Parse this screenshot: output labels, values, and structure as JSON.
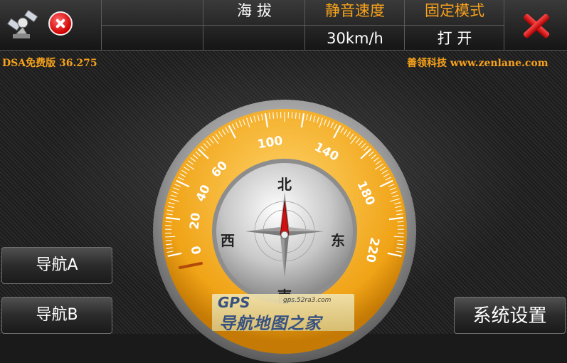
{
  "header": {
    "altitude_label": "海 拔",
    "altitude_value": "",
    "mute_speed_label": "静音速度",
    "mute_speed_value": "30km/h",
    "fixed_mode_label": "固定模式",
    "fixed_mode_value": "打 开"
  },
  "info": {
    "version": "DSA免费版 36.275",
    "company": "善领科技 www.zenlane.com"
  },
  "buttons": {
    "nav_a": "导航A",
    "nav_b": "导航B",
    "settings": "系统设置"
  },
  "gauge": {
    "speed_ticks": [
      "0",
      "20",
      "40",
      "60",
      "100",
      "140",
      "180",
      "220"
    ],
    "compass": {
      "north": "北",
      "east": "东",
      "west": "西",
      "south": "南"
    }
  },
  "watermark": {
    "logo": "GPS",
    "url": "gps.52ra3.com",
    "title": "导航地图之家"
  },
  "colors": {
    "accent": "#f7a21b",
    "gauge_ring": "#f0a316",
    "needle": "#d01010"
  }
}
